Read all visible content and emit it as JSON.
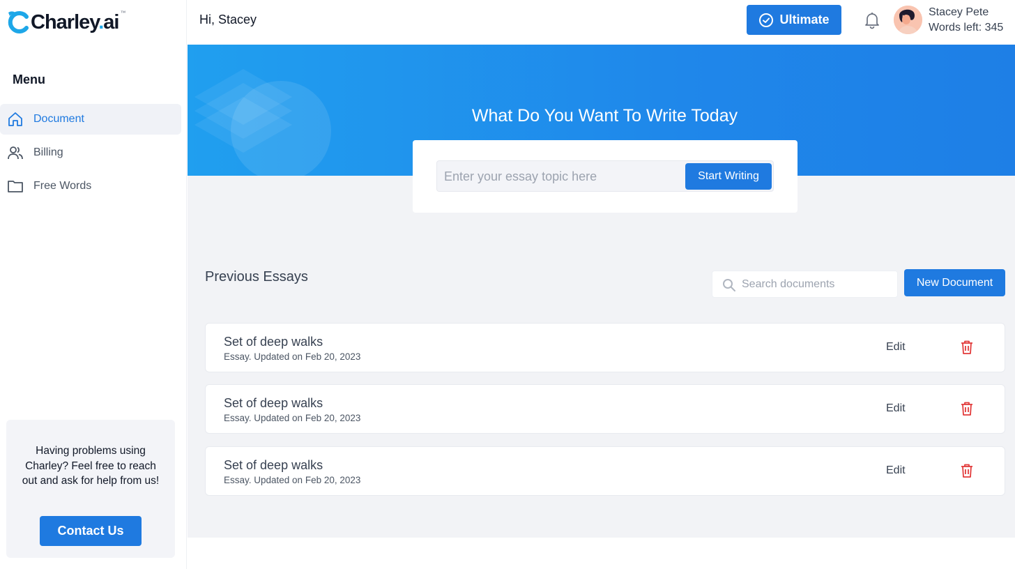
{
  "brand": {
    "logo_text": "Charley",
    "logo_dot": ".",
    "logo_suffix": "ai",
    "trademark": "™",
    "accent": "#1f7ae0",
    "logo_accent": "#1ea7e8"
  },
  "sidebar": {
    "menu_title": "Menu",
    "items": [
      {
        "label": "Document",
        "icon": "home-icon",
        "active": true
      },
      {
        "label": "Billing",
        "icon": "users-icon",
        "active": false
      },
      {
        "label": "Free Words",
        "icon": "folder-icon",
        "active": false
      }
    ],
    "help": {
      "text": "Having problems using Charley? Feel free to reach out and ask for help from us!",
      "button": "Contact Us"
    }
  },
  "header": {
    "greeting": "Hi, Stacey",
    "plan_button": "Ultimate",
    "user_name": "Stacey Pete",
    "words_left": "Words left: 345"
  },
  "hero": {
    "title": "What Do You Want To Write Today",
    "input_placeholder": "Enter your essay topic here",
    "button": "Start Writing"
  },
  "essays": {
    "title": "Previous Essays",
    "search_placeholder": "Search documents",
    "new_button": "New Document",
    "items": [
      {
        "title": "Set of deep walks",
        "meta": "Essay. Updated on Feb 20, 2023",
        "edit": "Edit"
      },
      {
        "title": "Set of deep walks",
        "meta": "Essay. Updated on Feb 20, 2023",
        "edit": "Edit"
      },
      {
        "title": "Set of deep walks",
        "meta": "Essay. Updated on Feb 20, 2023",
        "edit": "Edit"
      }
    ]
  }
}
